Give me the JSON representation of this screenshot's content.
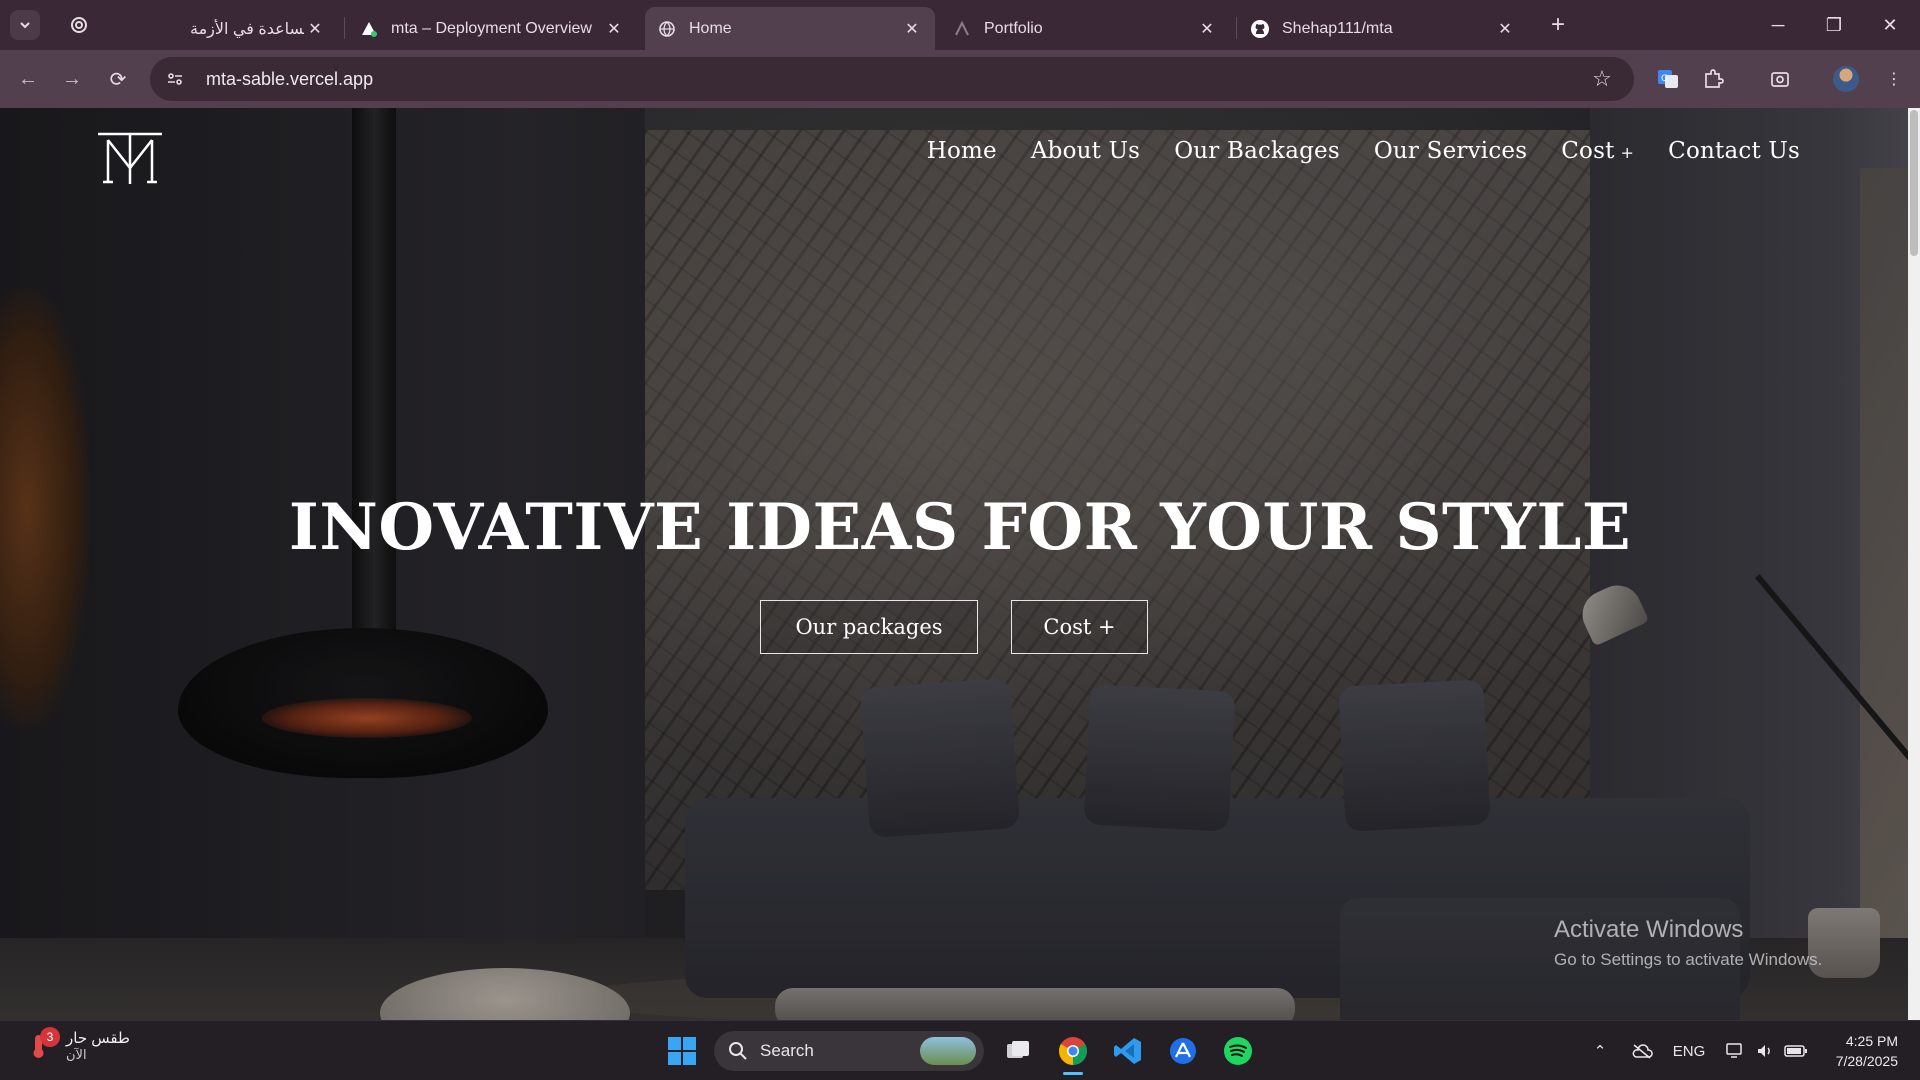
{
  "browser": {
    "tabs": [
      {
        "title": "مساعدة في الأزمة",
        "icon": "chatgpt-icon",
        "active": false
      },
      {
        "title": "mta – Deployment Overview",
        "icon": "vercel-icon",
        "active": false
      },
      {
        "title": "Home",
        "icon": "globe-icon",
        "active": true
      },
      {
        "title": "Portfolio",
        "icon": "portfolio-icon",
        "active": false
      },
      {
        "title": "Shehap111/mta",
        "icon": "github-icon",
        "active": false
      }
    ],
    "url": "mta-sable.vercel.app"
  },
  "site": {
    "nav": [
      {
        "label": "Home"
      },
      {
        "label": "About Us"
      },
      {
        "label": "Our Backages"
      },
      {
        "label": "Our Services"
      },
      {
        "label": "Cost",
        "suffix": "+"
      },
      {
        "label": "Contact Us"
      }
    ],
    "hero": {
      "title": "INOVATIVE IDEAS FOR YOUR STYLE",
      "button_packages": "Our packages",
      "button_cost": "Cost +"
    }
  },
  "watermark": {
    "line1": "Activate Windows",
    "line2": "Go to Settings to activate Windows."
  },
  "taskbar": {
    "weather_line1": "طقس حار",
    "weather_line2": "الآن",
    "weather_badge": "3",
    "search_label": "Search",
    "language": "ENG",
    "time": "4:25 PM",
    "date": "7/28/2025"
  }
}
